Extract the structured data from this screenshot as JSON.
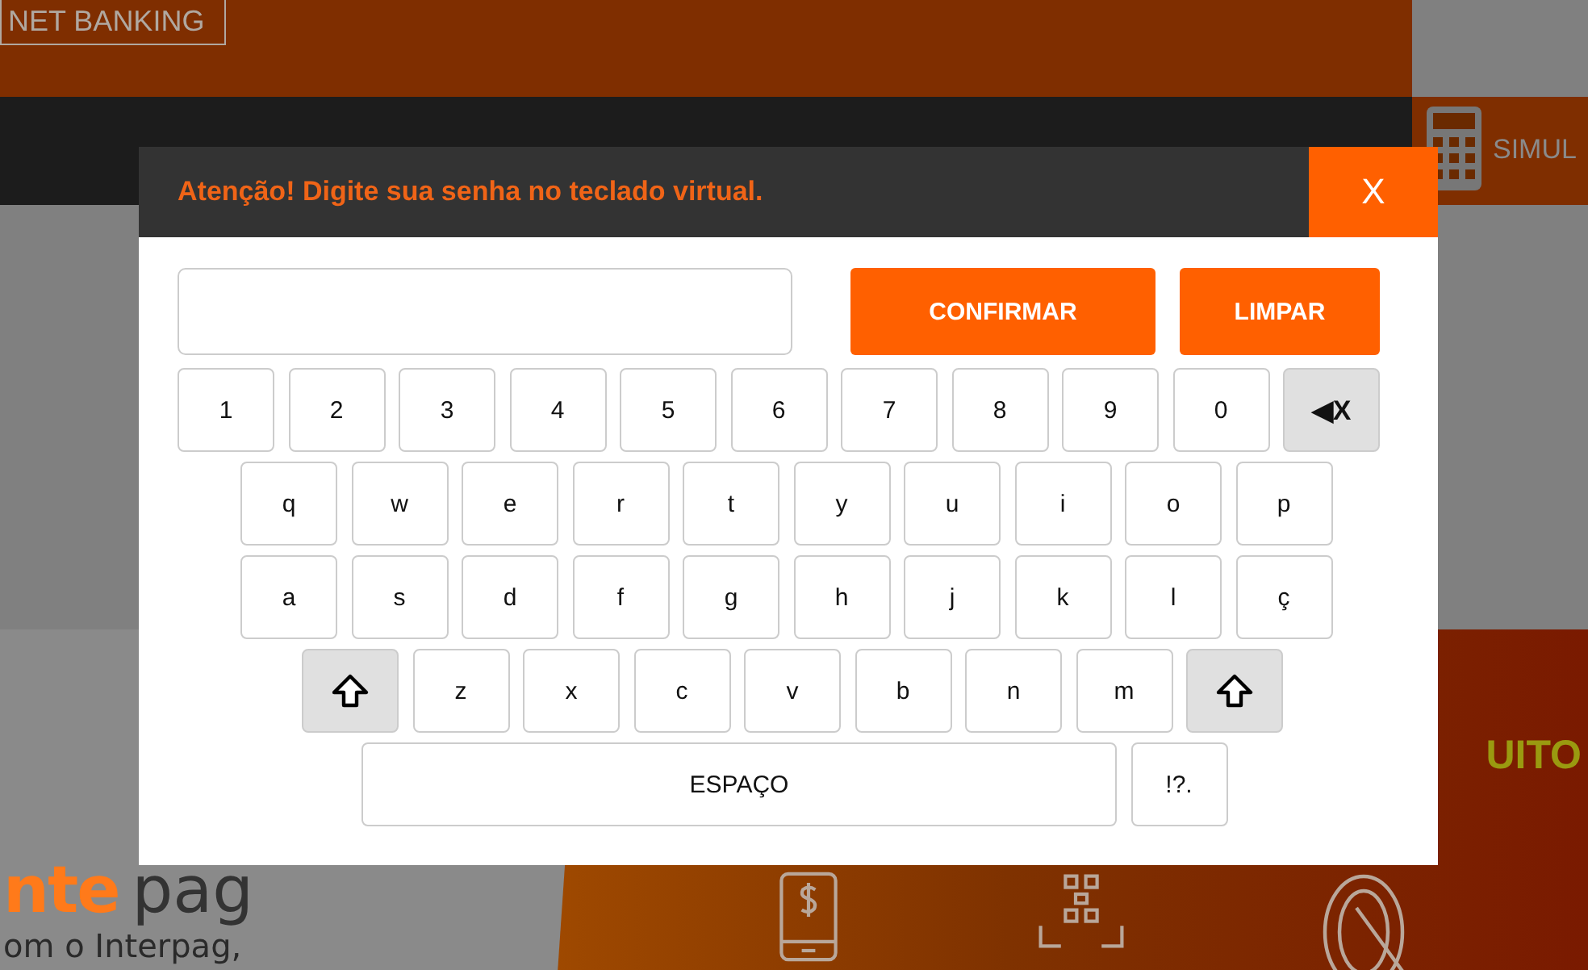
{
  "background": {
    "net_banking": "NET BANKING",
    "simulate": "SIMUL",
    "promo_title": "UITO",
    "brand_left": "nte",
    "brand_right": "pag",
    "tagline": "om o Interpag,"
  },
  "dialog": {
    "title": "Atenção! Digite sua senha no teclado virtual.",
    "close": "X",
    "buttons": [
      {
        "label": "CONFIRMAR",
        "kind": "confirm"
      },
      {
        "label": "LIMPAR",
        "kind": "clear"
      }
    ],
    "keyboard": [
      [
        {
          "kind": "char",
          "label": "1"
        },
        {
          "kind": "char",
          "label": "2"
        },
        {
          "kind": "char",
          "label": "3"
        },
        {
          "kind": "char",
          "label": "4"
        },
        {
          "kind": "char",
          "label": "5"
        },
        {
          "kind": "char",
          "label": "6"
        },
        {
          "kind": "char",
          "label": "7"
        },
        {
          "kind": "char",
          "label": "8"
        },
        {
          "kind": "char",
          "label": "9"
        },
        {
          "kind": "char",
          "label": "0"
        },
        {
          "kind": "backspace",
          "label": "◀X"
        }
      ],
      [
        {
          "kind": "char",
          "label": "q"
        },
        {
          "kind": "char",
          "label": "w"
        },
        {
          "kind": "char",
          "label": "e"
        },
        {
          "kind": "char",
          "label": "r"
        },
        {
          "kind": "char",
          "label": "t"
        },
        {
          "kind": "char",
          "label": "y"
        },
        {
          "kind": "char",
          "label": "u"
        },
        {
          "kind": "char",
          "label": "i"
        },
        {
          "kind": "char",
          "label": "o"
        },
        {
          "kind": "char",
          "label": "p"
        }
      ],
      [
        {
          "kind": "char",
          "label": "a"
        },
        {
          "kind": "char",
          "label": "s"
        },
        {
          "kind": "char",
          "label": "d"
        },
        {
          "kind": "char",
          "label": "f"
        },
        {
          "kind": "char",
          "label": "g"
        },
        {
          "kind": "char",
          "label": "h"
        },
        {
          "kind": "char",
          "label": "j"
        },
        {
          "kind": "char",
          "label": "k"
        },
        {
          "kind": "char",
          "label": "l"
        },
        {
          "kind": "char",
          "label": "ç"
        }
      ],
      [
        {
          "kind": "shift"
        },
        {
          "kind": "char",
          "label": "z"
        },
        {
          "kind": "char",
          "label": "x"
        },
        {
          "kind": "char",
          "label": "c"
        },
        {
          "kind": "char",
          "label": "v"
        },
        {
          "kind": "char",
          "label": "b"
        },
        {
          "kind": "char",
          "label": "n"
        },
        {
          "kind": "char",
          "label": "m"
        },
        {
          "kind": "shift"
        }
      ],
      [
        {
          "kind": "space",
          "label": "ESPAÇO"
        },
        {
          "kind": "char",
          "label": "!?."
        }
      ]
    ]
  }
}
